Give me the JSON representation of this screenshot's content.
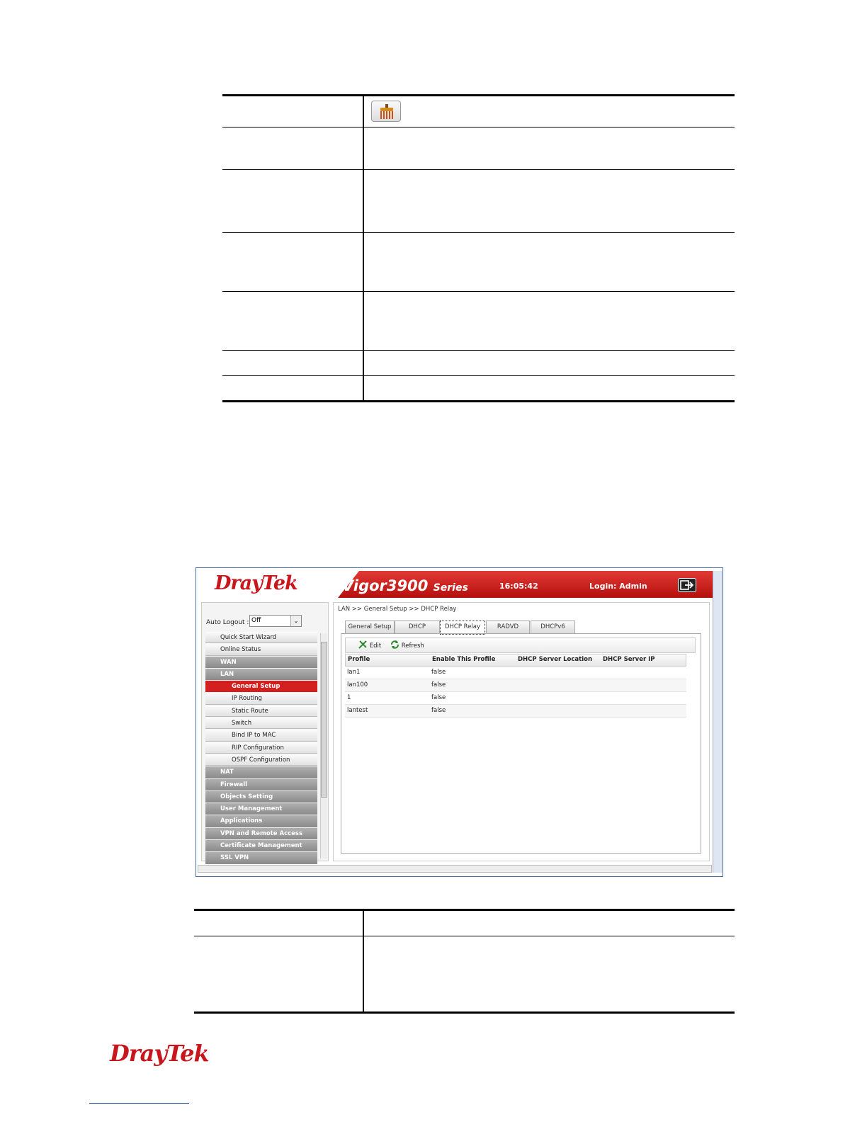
{
  "table1": {
    "rows": 7
  },
  "shot": {
    "brand": "DrayTek",
    "product": "Vigor3900",
    "product_series": "Series",
    "clock": "16:05:42",
    "login": "Login: Admin",
    "auto_logout_label": "Auto Logout :",
    "auto_logout_value": "Off",
    "menu": [
      {
        "label": "Quick Start Wizard",
        "kind": "plain"
      },
      {
        "label": "Online Status",
        "kind": "plain"
      },
      {
        "label": "WAN",
        "kind": "group"
      },
      {
        "label": "LAN",
        "kind": "group"
      },
      {
        "label": "General Setup",
        "kind": "active"
      },
      {
        "label": "IP Routing",
        "kind": "sub"
      },
      {
        "label": "Static Route",
        "kind": "sub"
      },
      {
        "label": "Switch",
        "kind": "sub"
      },
      {
        "label": "Bind IP to MAC",
        "kind": "sub"
      },
      {
        "label": "RIP Configuration",
        "kind": "sub"
      },
      {
        "label": "OSPF Configuration",
        "kind": "sub"
      },
      {
        "label": "NAT",
        "kind": "group"
      },
      {
        "label": "Firewall",
        "kind": "group"
      },
      {
        "label": "Objects Setting",
        "kind": "group"
      },
      {
        "label": "User Management",
        "kind": "group"
      },
      {
        "label": "Applications",
        "kind": "group"
      },
      {
        "label": "VPN and Remote Access",
        "kind": "group"
      },
      {
        "label": "Certificate Management",
        "kind": "group"
      },
      {
        "label": "SSL VPN",
        "kind": "group"
      }
    ],
    "breadcrumb": "LAN >> General Setup >> DHCP Relay",
    "tabs": [
      "General Setup",
      "DHCP",
      "DHCP Relay",
      "RADVD",
      "DHCPv6"
    ],
    "active_tab": "DHCP Relay",
    "toolbar": {
      "edit": "Edit",
      "refresh": "Refresh"
    },
    "columns": [
      "Profile",
      "Enable This Profile",
      "DHCP Server Location",
      "DHCP Server IP"
    ],
    "rows": [
      [
        "lan1",
        "false",
        "",
        ""
      ],
      [
        "lan100",
        "false",
        "",
        ""
      ],
      [
        "1",
        "false",
        "",
        ""
      ],
      [
        "lantest",
        "false",
        "",
        ""
      ]
    ],
    "colors": {
      "brand_red": "#c8161d",
      "active_menu": "#d41f1f"
    }
  },
  "footer": {
    "brand": "DrayTek"
  }
}
